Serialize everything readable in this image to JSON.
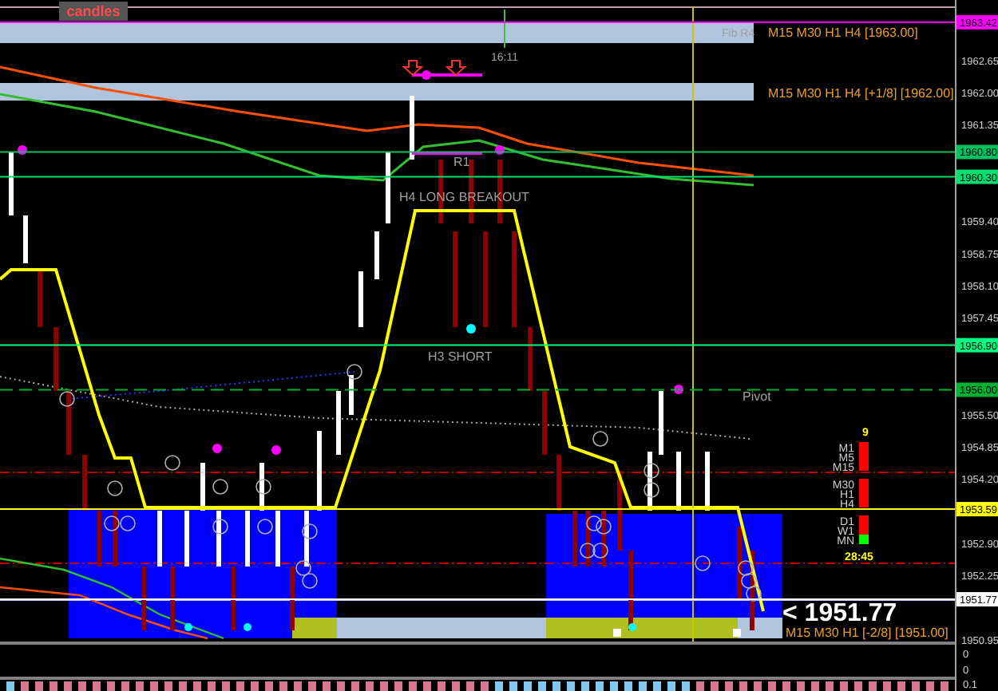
{
  "toolbar": {
    "candles_button": "candles"
  },
  "price_axis": {
    "ticks": [
      "1962.65",
      "1962.00",
      "1961.35",
      "1959.40",
      "1958.75",
      "1958.10",
      "1957.45",
      "1955.50",
      "1954.85",
      "1954.20",
      "1952.90",
      "1952.25",
      "1950.95"
    ]
  },
  "price_tags": [
    {
      "price": "1963.42",
      "color": "#ff00ff"
    },
    {
      "price": "1960.80",
      "color": "#00c060"
    },
    {
      "price": "1960.30",
      "color": "#00e070"
    },
    {
      "price": "1956.90",
      "color": "#00ff80"
    },
    {
      "price": "1956.00",
      "color": "#00b030"
    },
    {
      "price": "1953.59",
      "color": "#ffff00"
    },
    {
      "price": "1951.77",
      "color": "#ffffff"
    }
  ],
  "bands": [
    {
      "fib": "Fib R4",
      "label": "M15 M30 H1 H4  [1963.00]"
    },
    {
      "label": "M15 M30 H1 H4 [+1/8] [1962.00]"
    }
  ],
  "time_marker": "16:11",
  "chart_labels": [
    "R1",
    "H4 LONG BREAKOUT",
    "H3 SHORT",
    "Pivot"
  ],
  "timeframes": {
    "count": "9",
    "items": [
      {
        "label": "M1",
        "color": "#ff0000"
      },
      {
        "label": "M5",
        "color": "#ff0000"
      },
      {
        "label": "M15",
        "color": "#ff0000"
      },
      {
        "label": "M30",
        "color": "#ff0000"
      },
      {
        "label": "H1",
        "color": "#ff0000"
      },
      {
        "label": "H4",
        "color": "#ff0000"
      },
      {
        "label": "D1",
        "color": "#ff0000"
      },
      {
        "label": "W1",
        "color": "#ff0000"
      },
      {
        "label": "MN",
        "color": "#00ff00"
      }
    ],
    "countdown": "28:45"
  },
  "current_price": {
    "label": "< 1951.77",
    "level_label": "M15 M30 H1 [-2/8] [1951.00]"
  },
  "lower_panels": [
    "0",
    "0",
    "0.1"
  ]
}
